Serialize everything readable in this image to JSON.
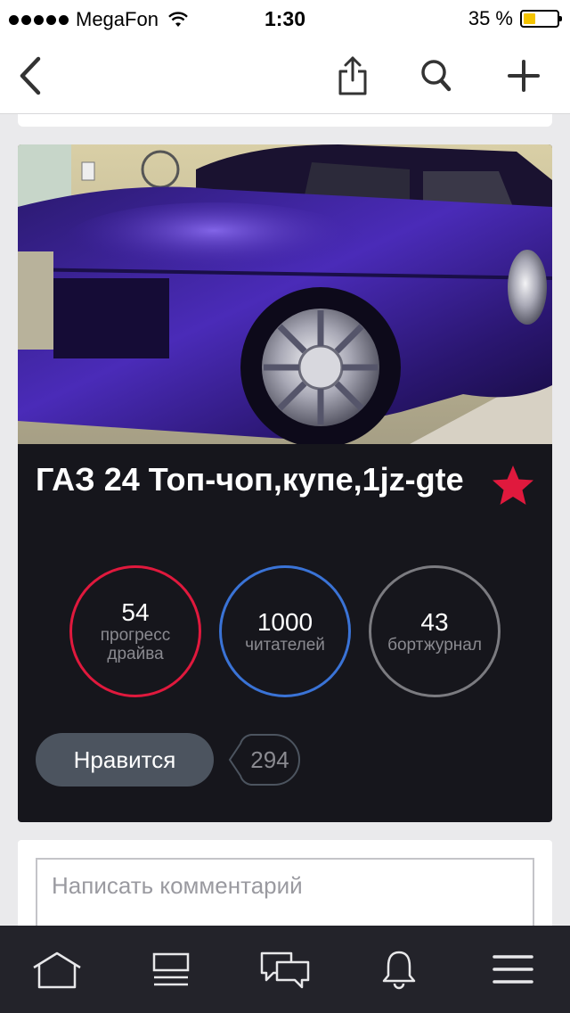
{
  "status_bar": {
    "carrier": "MegaFon",
    "time": "1:30",
    "battery_percent": "35 %",
    "battery_level": 0.35,
    "icons": [
      "signal-dots-icon",
      "wifi-icon",
      "battery-icon"
    ]
  },
  "nav": {
    "icons": [
      "back-arrow-icon",
      "share-icon",
      "search-icon",
      "plus-icon"
    ]
  },
  "car": {
    "image_icon": "car-photo",
    "title": "ГАЗ 24 Топ-чоп,купе,1jz-gte",
    "favorite_icon": "star-icon",
    "stats": [
      {
        "value": "54",
        "label": "прогресс драйва",
        "color": "#e0193d"
      },
      {
        "value": "1000",
        "label": "читателей",
        "color": "#3a73d6"
      },
      {
        "value": "43",
        "label": "бортжурнал",
        "color": "#7b7b80"
      }
    ],
    "like_label": "Нравится",
    "like_count": "294"
  },
  "comment": {
    "placeholder": "Написать комментарий"
  },
  "tabbar": {
    "icons": [
      "home-icon",
      "feed-icon",
      "messages-icon",
      "bell-icon",
      "menu-icon"
    ]
  },
  "colors": {
    "accent_red": "#e0193d",
    "accent_blue": "#3a73d6",
    "card_dark": "#16161c",
    "tabbar_dark": "#23232a"
  }
}
